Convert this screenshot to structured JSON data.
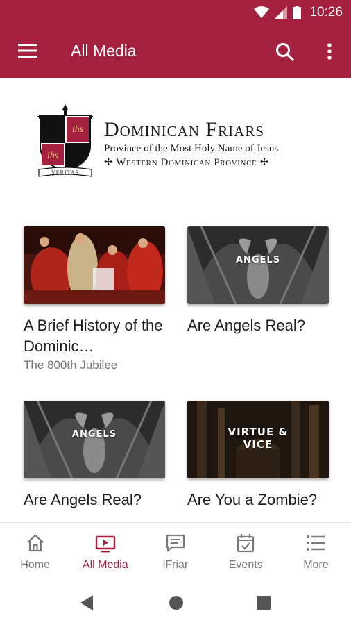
{
  "status_bar": {
    "time": "10:26"
  },
  "app_bar": {
    "title": "All Media"
  },
  "logo": {
    "shield_motto": "VERITAS",
    "shield_letters": "ihs",
    "title": "Dominican Friars",
    "subtitle": "Province of the Most Holy Name of Jesus",
    "province": "✢ Western Dominican Province ✢"
  },
  "media": [
    {
      "title": "A Brief History of the Dominic…",
      "subtitle": "The 800th Jubilee",
      "thumb_label": ""
    },
    {
      "title": "Are Angels Real?",
      "subtitle": "",
      "thumb_label": "ANGELS"
    },
    {
      "title": "Are Angels Real?",
      "subtitle": "",
      "thumb_label": "ANGELS"
    },
    {
      "title": "Are You a Zombie?",
      "subtitle": "",
      "thumb_label": "VIRTUE & VICE"
    }
  ],
  "bottom_nav": [
    {
      "label": "Home",
      "icon": "home-icon",
      "active": false
    },
    {
      "label": "All Media",
      "icon": "media-tv-icon",
      "active": true
    },
    {
      "label": "iFriar",
      "icon": "chat-icon",
      "active": false
    },
    {
      "label": "Events",
      "icon": "calendar-check-icon",
      "active": false
    },
    {
      "label": "More",
      "icon": "list-icon",
      "active": false
    }
  ],
  "colors": {
    "primary": "#a3203f",
    "inactive": "#7a7a7a",
    "text": "#1f1f1f",
    "subtext": "#757575"
  }
}
